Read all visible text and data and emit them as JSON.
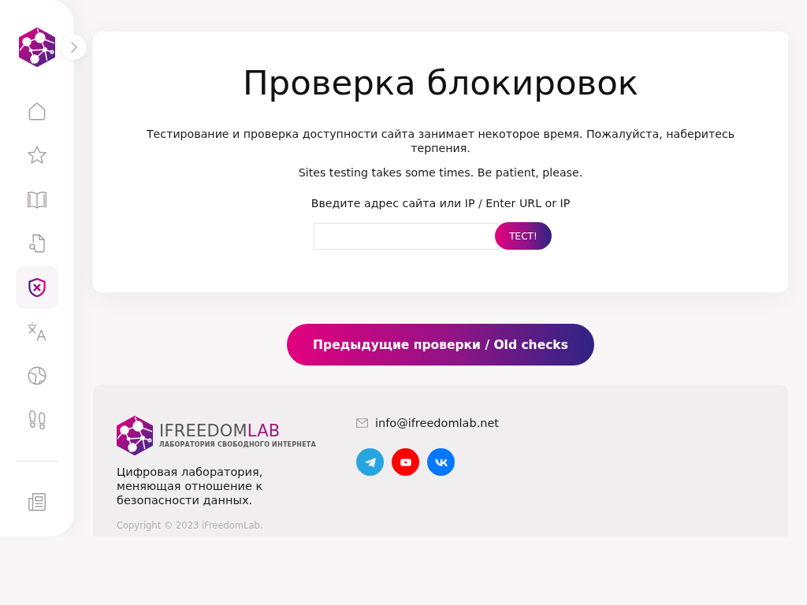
{
  "sidebar": {
    "nav_items": [
      {
        "selected": false
      },
      {
        "selected": false
      },
      {
        "selected": false
      },
      {
        "selected": false
      },
      {
        "selected": true
      },
      {
        "selected": false
      },
      {
        "selected": false
      },
      {
        "selected": false
      }
    ],
    "extra_items": [
      {
        "selected": false
      }
    ]
  },
  "check_card": {
    "title": "Проверка блокировок",
    "paragraphs": [
      "Тестирование и проверка доступности сайта занимает некоторое время. Пожалуйста, наберитесь терпения.",
      "Sites testing takes some times. Be patient, please."
    ],
    "prompt": "Введите адрес сайта или IP / Enter URL or IP",
    "test_button": {
      "label": "ТЕСТ!"
    }
  },
  "old_checks_button": {
    "label": "Предыдущие проверки / Old checks"
  },
  "footer": {
    "logo": {
      "name_main": "IFREEDOM",
      "name_accent": "LAB",
      "tagline": "ЛАБОРАТОРИЯ СВОБОДНОГО ИНТЕРНЕТА"
    },
    "description": "Цифровая лаборатория, меняющая отношение к безопасности данных.",
    "copyright": "Copyright © 2023 iFreedomLab.",
    "email": "info@ifreedomlab.net",
    "socials": [
      {
        "color": "#27a5e0"
      },
      {
        "color": "#ff0000"
      },
      {
        "color": "#0077ff"
      }
    ]
  }
}
